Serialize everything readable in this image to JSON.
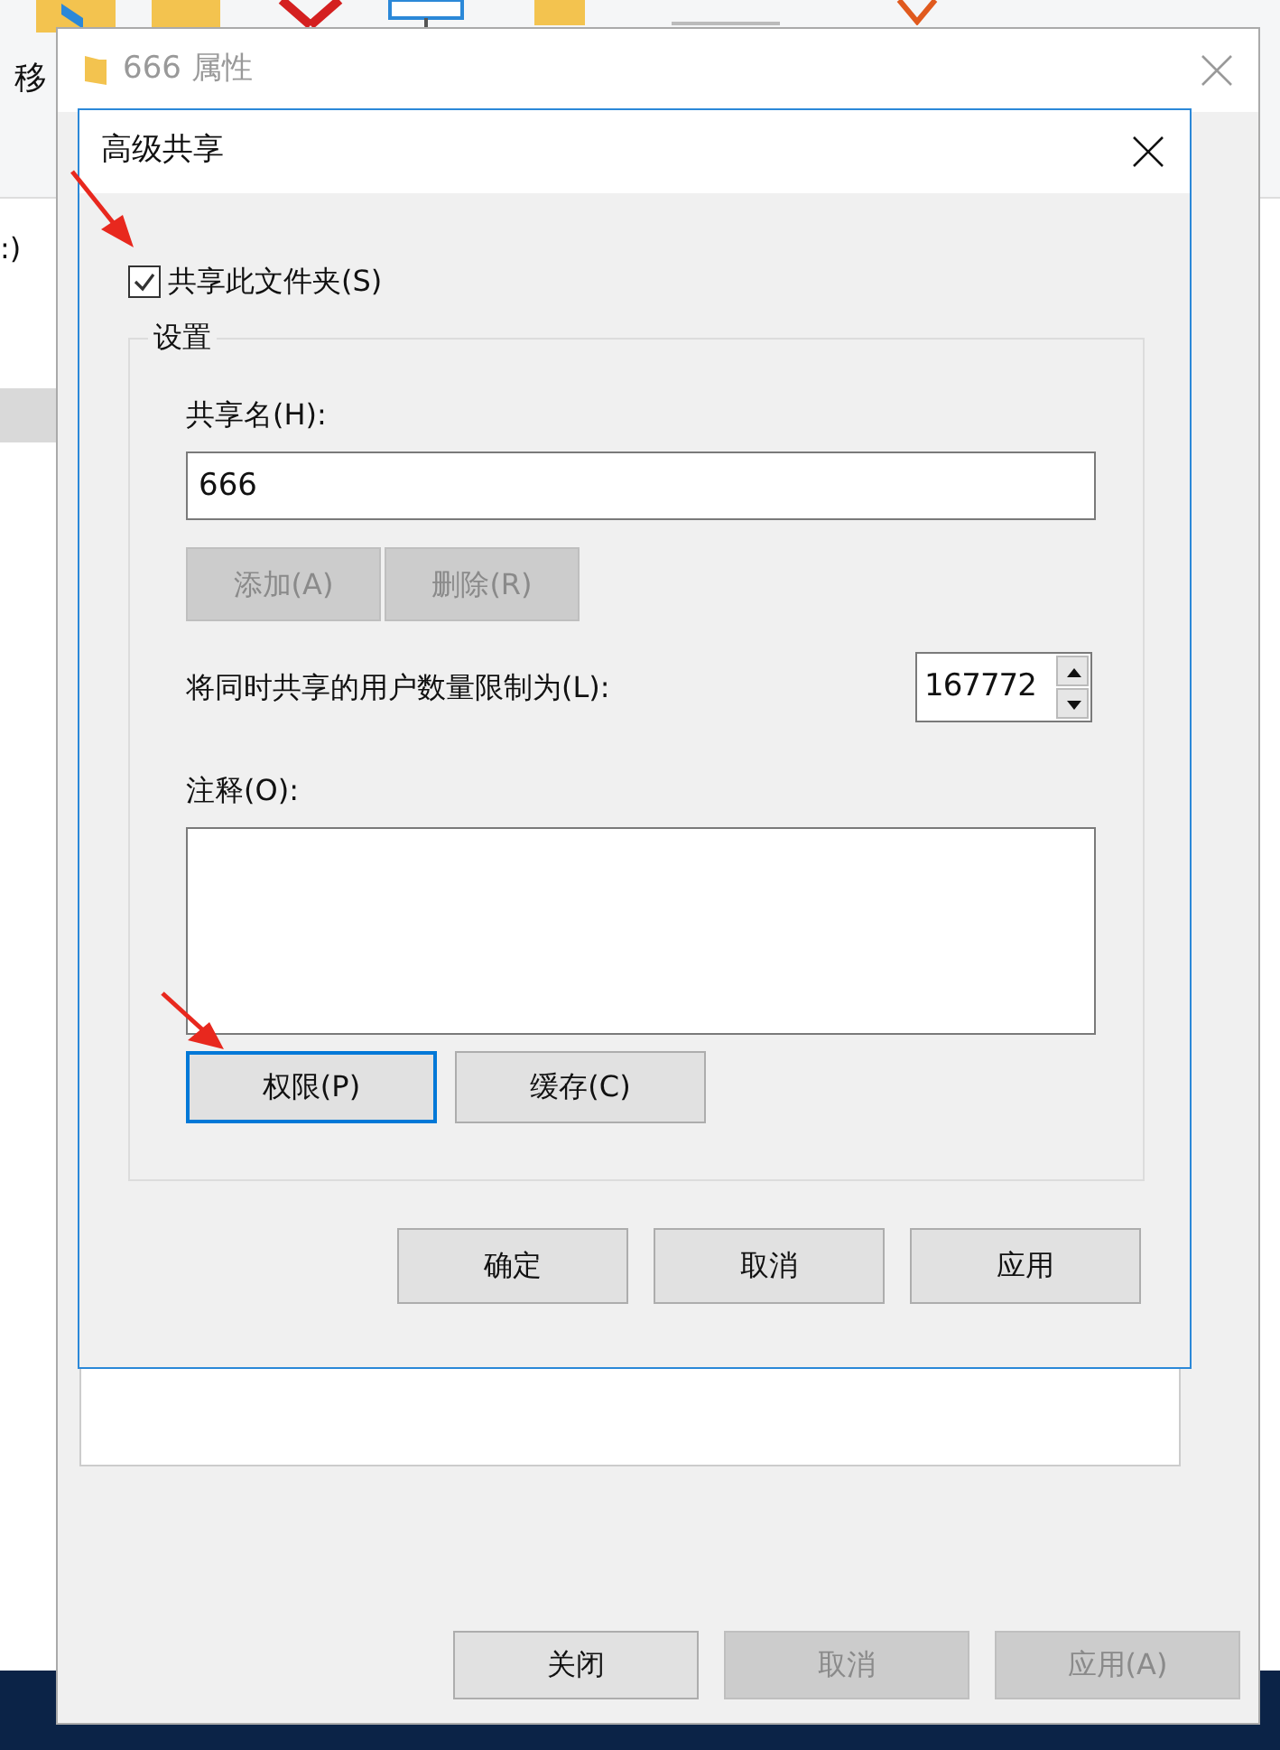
{
  "background_window": {
    "ribbon_label": "移",
    "sidebar_text": ":)"
  },
  "properties_window": {
    "title": "666 属性",
    "buttons": [
      {
        "label": "关闭",
        "disabled": false
      },
      {
        "label": "取消",
        "disabled": true
      },
      {
        "label": "应用(A)",
        "disabled": true
      }
    ]
  },
  "dialog": {
    "title": "高级共享",
    "share_checkbox": {
      "label": "共享此文件夹(S)",
      "checked": true
    },
    "group": {
      "title": "设置",
      "share_name": {
        "label": "共享名(H):",
        "value": "666"
      },
      "name_buttons": [
        {
          "label": "添加(A)",
          "disabled": true
        },
        {
          "label": "删除(R)",
          "disabled": true
        }
      ],
      "user_limit": {
        "label": "将同时共享的用户数量限制为(L):",
        "value": "167772"
      },
      "comment": {
        "label": "注释(O):"
      },
      "buttons": [
        {
          "label": "权限(P)",
          "focused": true
        },
        {
          "label": "缓存(C)",
          "focused": false
        }
      ]
    },
    "buttons": [
      {
        "label": "确定",
        "disabled": false
      },
      {
        "label": "取消",
        "disabled": false
      },
      {
        "label": "应用",
        "disabled": false
      }
    ]
  }
}
